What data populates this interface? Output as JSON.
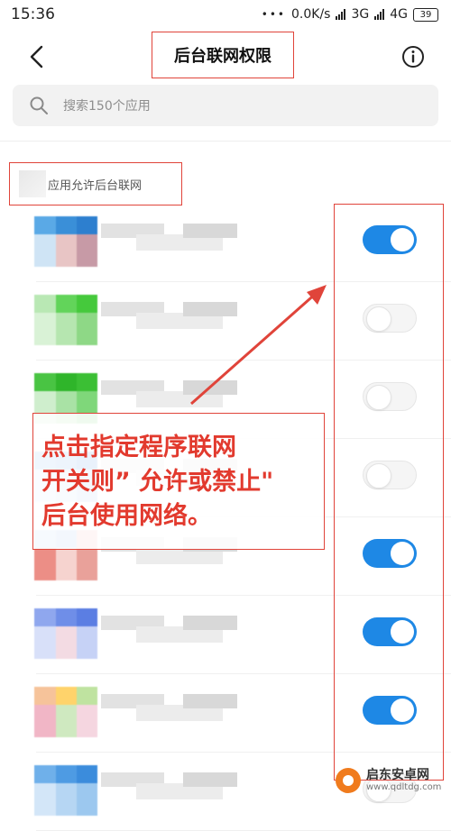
{
  "status_bar": {
    "time": "15:36",
    "dots": "•••",
    "speed": "0.0K/s",
    "network_3g": "3G",
    "network_4g": "4G",
    "battery": "39"
  },
  "header": {
    "title": "后台联网权限",
    "back_icon": "chevron-left-icon",
    "info_icon": "info-circle-icon"
  },
  "search": {
    "placeholder": "搜索150个应用"
  },
  "section": {
    "label": "应用允许后台联网"
  },
  "apps": [
    {
      "enabled": true,
      "icon_colors": [
        "#5aa9e6",
        "#3a8fd8",
        "#2d7fcf",
        "#cfe4f5",
        "#e8c5c5",
        "#c79aa6"
      ]
    },
    {
      "enabled": false,
      "icon_colors": [
        "#b9e8b4",
        "#62d45a",
        "#45c93c",
        "#d9f2d6",
        "#b6e6b0",
        "#8ed886"
      ]
    },
    {
      "enabled": false,
      "icon_colors": [
        "#49c443",
        "#2fb52a",
        "#3bbf34",
        "#cfeecd",
        "#a9e2a5",
        "#7fd77a"
      ]
    },
    {
      "enabled": false,
      "icon_colors": [
        "#7fb0e8",
        "#6aa2e3",
        "#4f8fdb",
        "#d7e7f8",
        "#c3d9f3",
        "#a8c7ee"
      ]
    },
    {
      "enabled": true,
      "icon_colors": [
        "#b6d0f0",
        "#9fbfe9",
        "#f1b6b0",
        "#ec8e86",
        "#f6d3cf",
        "#e9a19a"
      ]
    },
    {
      "enabled": true,
      "icon_colors": [
        "#8fa7ee",
        "#6f8ee8",
        "#5b7ee3",
        "#d8e0f9",
        "#f3dbe3",
        "#c6d2f6"
      ]
    },
    {
      "enabled": true,
      "icon_colors": [
        "#f6c39a",
        "#ffd36b",
        "#bfe3a0",
        "#f1b6c6",
        "#cfe9c0",
        "#f5d6e0"
      ]
    },
    {
      "enabled": false,
      "icon_colors": [
        "#6fb0ea",
        "#4e9be3",
        "#3b8cdc",
        "#d3e6f8",
        "#b6d6f3",
        "#9cc8ef"
      ]
    }
  ],
  "annotation": {
    "line1": "点击指定程序联网",
    "line2": "开关则” 允许或禁止\"",
    "line3": "后台使用网络。"
  },
  "watermark": {
    "name": "启东安卓网",
    "url": "www.qdltdg.com"
  },
  "colors": {
    "toggle_on": "#1e88e5",
    "annotation_red": "#e0443a"
  }
}
